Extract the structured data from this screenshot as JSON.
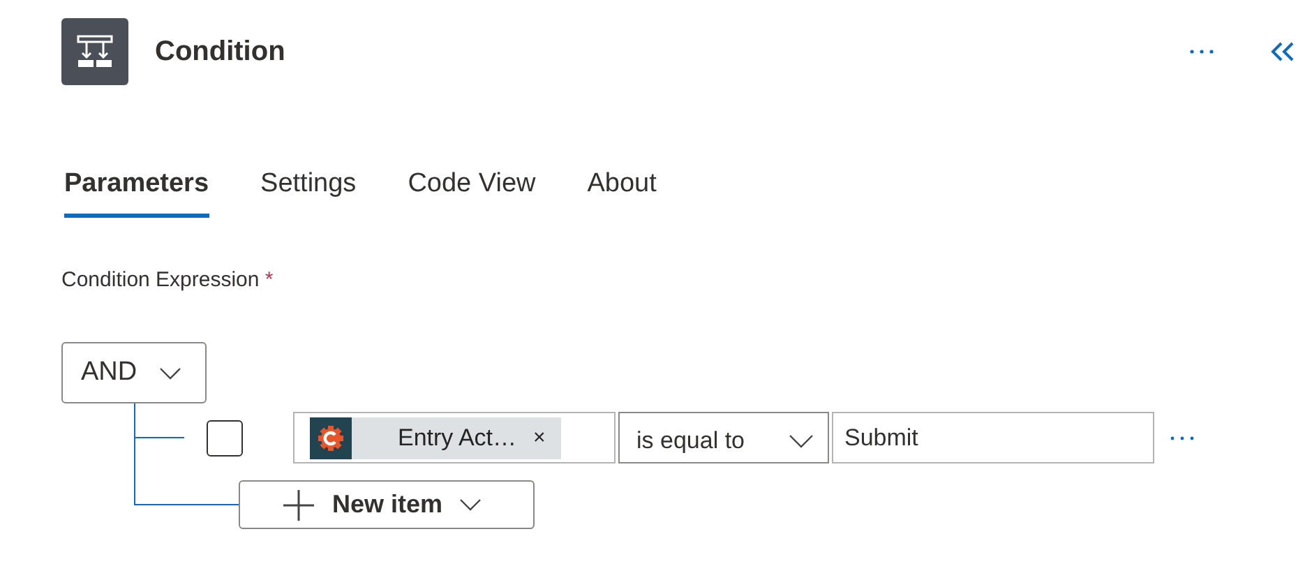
{
  "header": {
    "title": "Condition"
  },
  "tabs": [
    {
      "label": "Parameters",
      "selected": true
    },
    {
      "label": "Settings",
      "selected": false
    },
    {
      "label": "Code View",
      "selected": false
    },
    {
      "label": "About",
      "selected": false
    }
  ],
  "condition": {
    "label": "Condition Expression",
    "required_mark": "*",
    "group_operator": "AND",
    "rows": [
      {
        "checked": false,
        "token": "Entry Act…",
        "token_remove": "×",
        "operator": "is equal to",
        "value": "Submit"
      }
    ],
    "new_item": "New item"
  }
}
